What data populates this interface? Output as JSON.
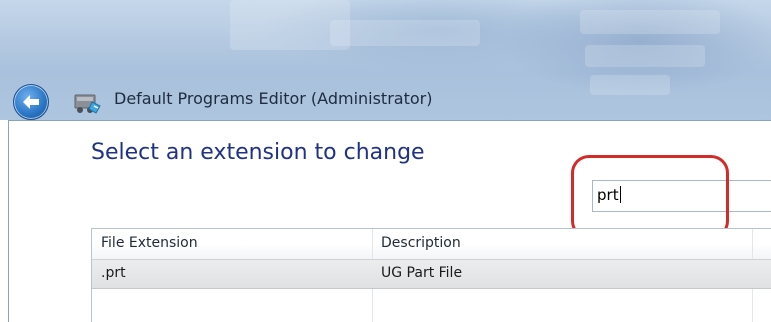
{
  "window": {
    "title": "Default Programs Editor (Administrator)"
  },
  "titlebar": {
    "back_icon": "back-arrow-icon",
    "app_icon": "default-programs-editor-icon"
  },
  "main": {
    "heading": "Select an extension to change",
    "search": {
      "value": "prt"
    },
    "list": {
      "columns": [
        "File Extension",
        "Description"
      ],
      "rows": [
        {
          "extension": ".prt",
          "description": "UG Part File",
          "selected": true
        }
      ]
    }
  },
  "colors": {
    "heading": "#1e3287",
    "highlight_ring": "#d42a2a",
    "selected_row": "#e3e4e6"
  }
}
